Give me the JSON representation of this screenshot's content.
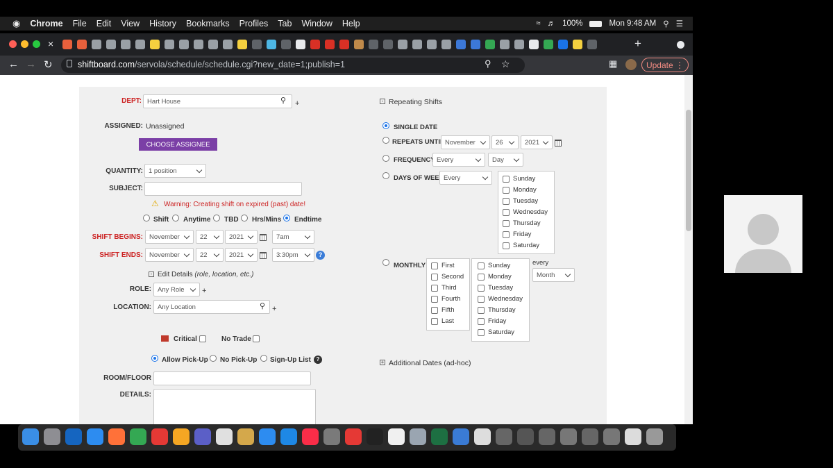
{
  "menubar": {
    "app": "Chrome",
    "items": [
      "File",
      "Edit",
      "View",
      "History",
      "Bookmarks",
      "Profiles",
      "Tab",
      "Window",
      "Help"
    ],
    "battery": "100%",
    "clock": "Mon 9:48 AM"
  },
  "browser": {
    "url_host": "shiftboard.com",
    "url_path": "/servola/schedule/schedule.cgi?new_date=1;publish=1",
    "update_label": "Update"
  },
  "form": {
    "dept_label": "DEPT:",
    "dept_value": "Hart House",
    "assigned_label": "ASSIGNED:",
    "assigned_value": "Unassigned",
    "choose_assignee": "CHOOSE ASSIGNEE",
    "quantity_label": "QUANTITY:",
    "quantity_value": "1 position",
    "subject_label": "SUBJECT:",
    "warning": "Warning: Creating shift on expired (past) date!",
    "time_modes": [
      "Shift",
      "Anytime",
      "TBD",
      "Hrs/Mins",
      "Endtime"
    ],
    "shift_begins_label": "SHIFT BEGINS:",
    "begins": {
      "month": "November",
      "day": "22",
      "year": "2021",
      "time": "7am"
    },
    "shift_ends_label": "SHIFT ENDS:",
    "ends": {
      "month": "November",
      "day": "22",
      "year": "2021",
      "time": "3:30pm"
    },
    "edit_details": "Edit Details",
    "edit_details_hint": "(role, location, etc.)",
    "role_label": "ROLE:",
    "role_value": "Any Role",
    "location_label": "LOCATION:",
    "location_value": "Any Location",
    "critical": "Critical",
    "no_trade": "No Trade",
    "pickup_options": [
      "Allow Pick-Up",
      "No Pick-Up",
      "Sign-Up List"
    ],
    "room_label": "ROOM/FLOOR",
    "details_label": "DETAILS:"
  },
  "repeating": {
    "title": "Repeating Shifts",
    "single_date": "SINGLE DATE",
    "repeats_until": "REPEATS UNTIL",
    "until": {
      "month": "November",
      "day": "26",
      "year": "2021"
    },
    "frequency": "FREQUENCY",
    "freq_every": "Every",
    "freq_unit": "Day",
    "days_of_week": "DAYS OF WEEK",
    "dow_every": "Every",
    "weekdays": [
      "Sunday",
      "Monday",
      "Tuesday",
      "Wednesday",
      "Thursday",
      "Friday",
      "Saturday"
    ],
    "monthly": "MONTHLY",
    "ordinals": [
      "First",
      "Second",
      "Third",
      "Fourth",
      "Fifth",
      "Last"
    ],
    "every_label": "every",
    "month_unit": "Month",
    "additional_dates": "Additional Dates (ad-hoc)"
  },
  "colors": {
    "accent_purple": "#7b3fa6",
    "label_red": "#cc2222",
    "radio_blue": "#1a73e8"
  }
}
